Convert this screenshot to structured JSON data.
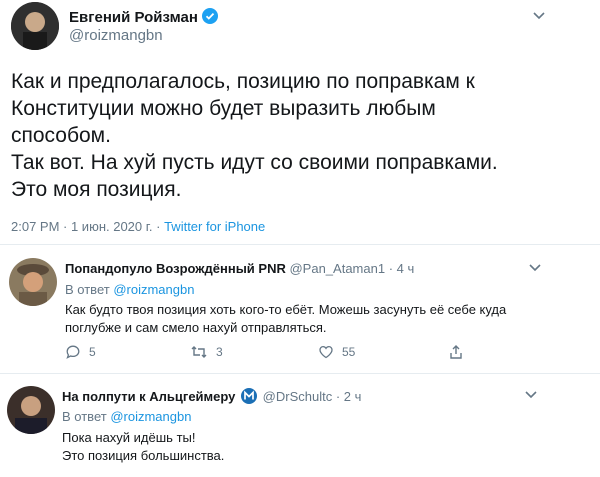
{
  "main_tweet": {
    "author_name": "Евгений Ройзман",
    "author_handle": "@roizmangbn",
    "text_lines": [
      "Как и предполагалось, позицию по поправкам к",
      "Конституции можно будет выразить любым",
      "способом.",
      "Так вот. На хуй пусть идут со своими поправками.",
      "Это моя позиция."
    ],
    "meta_time_date": "2:07 PM · 1 июн. 2020 г. · ",
    "meta_source": "Twitter for iPhone"
  },
  "replies": [
    {
      "author_name": "Попандопуло Возрождённый PNR",
      "author_handle": "@Pan_Ataman1",
      "time": "· 4 ч",
      "reply_label": "В ответ ",
      "reply_to": "@roizmangbn",
      "text_lines": [
        "Как будто твоя позиция хоть кого-то ебёт. Можешь засунуть её себе куда",
        "поглубже и сам смело нахуй отправляться."
      ],
      "reply_count": "5",
      "retweet_count": "3",
      "like_count": "55"
    },
    {
      "author_name": "На полпути к Альцгеймеру",
      "author_handle": "@DrSchultc",
      "time": "· 2 ч",
      "reply_label": "В ответ ",
      "reply_to": "@roizmangbn",
      "text_lines": [
        "Пока нахуй идёшь ты!",
        "Это позиция большинства."
      ]
    }
  ],
  "colors": {
    "text": "#14171a",
    "muted": "#657786",
    "link": "#1b95e0",
    "verified": "#1da1f2",
    "divider": "#e6ecf0"
  }
}
